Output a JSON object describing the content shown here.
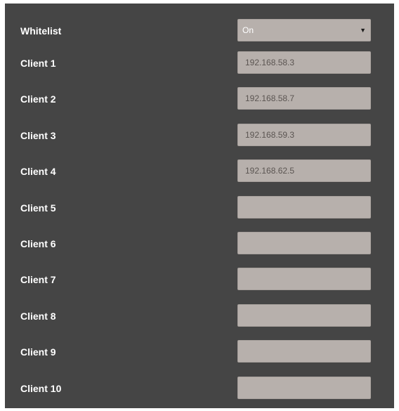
{
  "whitelist": {
    "label": "Whitelist",
    "value": "On"
  },
  "clients": [
    {
      "label": "Client 1",
      "value": "192.168.58.3"
    },
    {
      "label": "Client 2",
      "value": "192.168.58.7"
    },
    {
      "label": "Client 3",
      "value": "192.168.59.3"
    },
    {
      "label": "Client 4",
      "value": "192.168.62.5"
    },
    {
      "label": "Client 5",
      "value": ""
    },
    {
      "label": "Client 6",
      "value": ""
    },
    {
      "label": "Client 7",
      "value": ""
    },
    {
      "label": "Client 8",
      "value": ""
    },
    {
      "label": "Client 9",
      "value": ""
    },
    {
      "label": "Client 10",
      "value": ""
    }
  ],
  "icons": {
    "dropdown": "caret-down-icon"
  },
  "colors": {
    "panel_background": "#454545",
    "field_background": "#b7b0ac",
    "label_text": "#ffffff",
    "field_text": "#5b5552"
  }
}
